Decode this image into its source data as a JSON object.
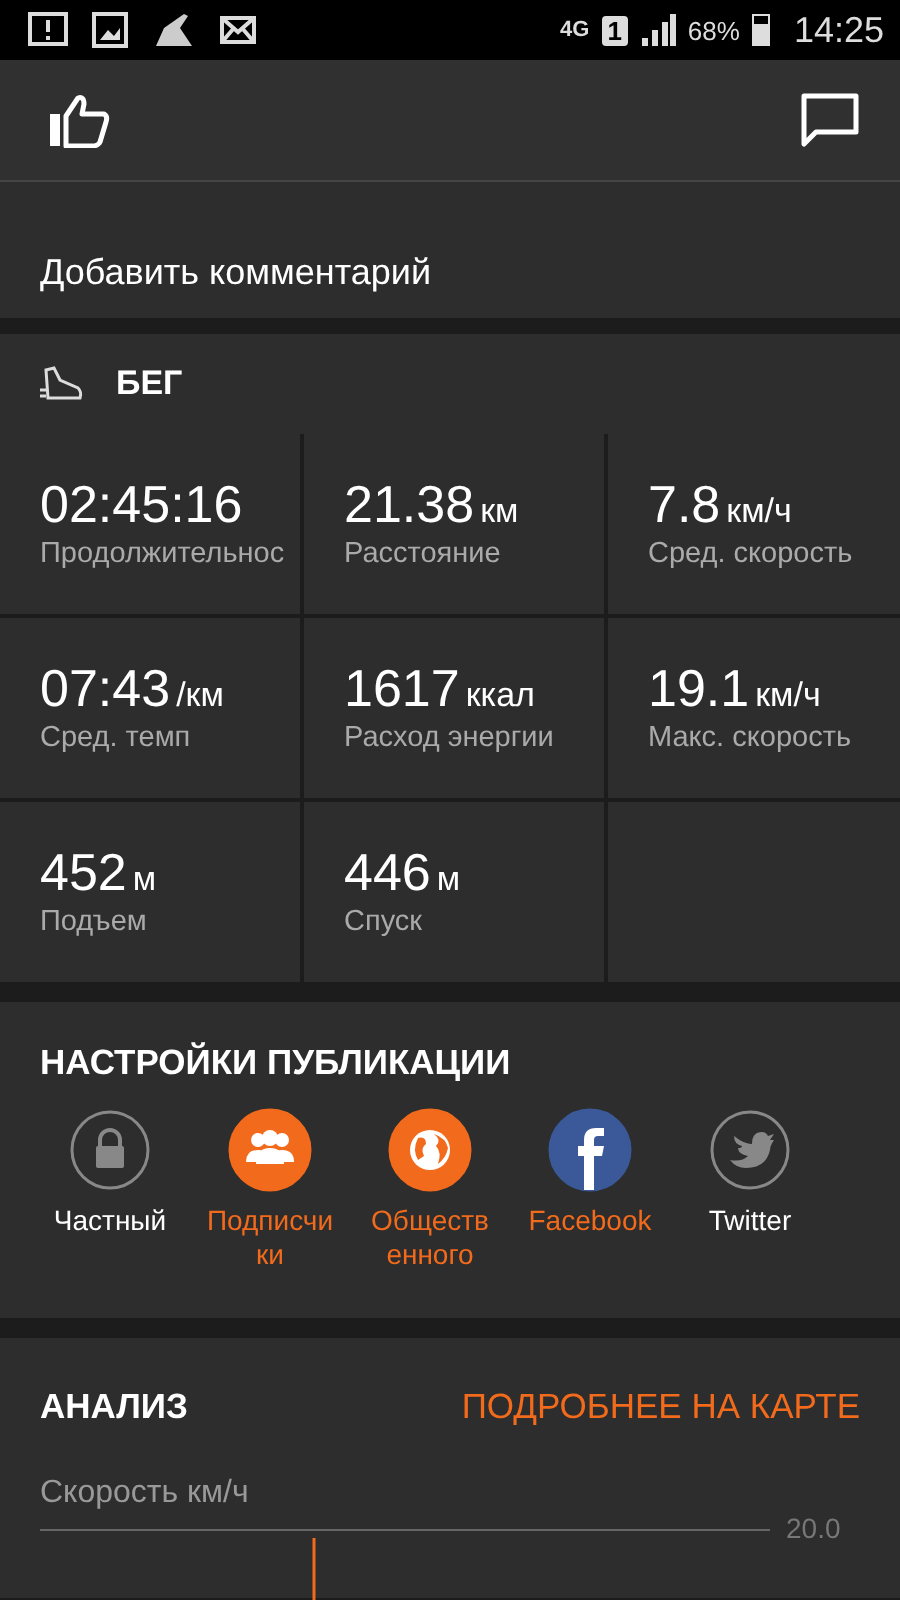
{
  "status_bar": {
    "network": "4G",
    "sim": "1",
    "battery": "68%",
    "time": "14:25"
  },
  "comment": {
    "placeholder": "Добавить комментарий"
  },
  "activity": {
    "title": "БЕГ",
    "stats": [
      {
        "value": "02:45:16",
        "label": "Продолжительнос"
      },
      {
        "value": "21.38",
        "unit": "км",
        "label": "Расстояние"
      },
      {
        "value": "7.8",
        "unit": "км/ч",
        "label": "Сред. скорость"
      },
      {
        "value": "07:43",
        "unit": "/км",
        "label": "Сред. темп"
      },
      {
        "value": "1617",
        "unit": "ккал",
        "label": "Расход энергии"
      },
      {
        "value": "19.1",
        "unit": "км/ч",
        "label": "Макс. скорость"
      },
      {
        "value": "452",
        "unit": "м",
        "label": "Подъем"
      },
      {
        "value": "446",
        "unit": "м",
        "label": "Спуск"
      }
    ]
  },
  "publish": {
    "title": "НАСТРОЙКИ ПУБЛИКАЦИИ",
    "options": [
      {
        "kind": "private",
        "label": "Частный",
        "selected": false
      },
      {
        "kind": "followers",
        "label": "Подписчи ки",
        "selected": true
      },
      {
        "kind": "public",
        "label": "Обществ енного",
        "selected": true
      },
      {
        "kind": "facebook",
        "label": "Facebook",
        "selected": true
      },
      {
        "kind": "twitter",
        "label": "Twitter",
        "selected": false
      }
    ]
  },
  "analysis": {
    "title": "АНАЛИЗ",
    "link": "ПОДРОБНЕЕ НА КАРТЕ",
    "chart_title": "Скорость км/ч",
    "tick": "20.0"
  }
}
